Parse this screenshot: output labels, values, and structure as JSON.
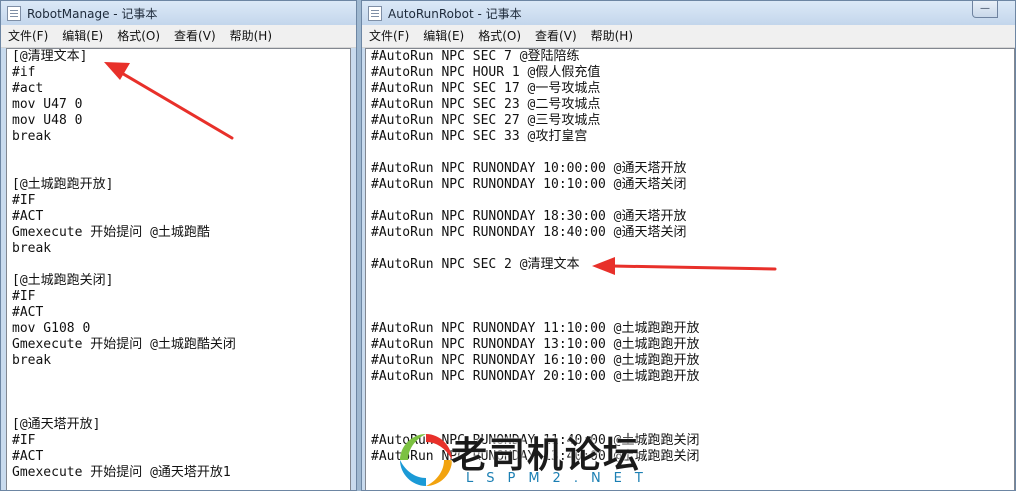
{
  "left_window": {
    "title": "RobotManage - 记事本",
    "menu": [
      "文件(F)",
      "编辑(E)",
      "格式(O)",
      "查看(V)",
      "帮助(H)"
    ],
    "lines": [
      "[@清理文本]",
      "#if",
      "#act",
      "mov U47 0",
      "mov U48 0",
      "break",
      "",
      "",
      "[@土城跑跑开放]",
      "#IF",
      "#ACT",
      "Gmexecute 开始提问 @土城跑酷",
      "break",
      "",
      "[@土城跑跑关闭]",
      "#IF",
      "#ACT",
      "mov G108 0",
      "Gmexecute 开始提问 @土城跑酷关闭",
      "break",
      "",
      "",
      "",
      "[@通天塔开放]",
      "#IF",
      "#ACT",
      "Gmexecute 开始提问 @通天塔开放1"
    ]
  },
  "right_window": {
    "title": "AutoRunRobot - 记事本",
    "menu": [
      "文件(F)",
      "编辑(E)",
      "格式(O)",
      "查看(V)",
      "帮助(H)"
    ],
    "lines": [
      "#AutoRun NPC SEC 7 @登陆陪练",
      "#AutoRun NPC HOUR 1 @假人假充值",
      "#AutoRun NPC SEC 17 @一号攻城点",
      "#AutoRun NPC SEC 23 @二号攻城点",
      "#AutoRun NPC SEC 27 @三号攻城点",
      "#AutoRun NPC SEC 33 @攻打皇宫",
      "",
      "#AutoRun NPC RUNONDAY 10:00:00 @通天塔开放",
      "#AutoRun NPC RUNONDAY 10:10:00 @通天塔关闭",
      "",
      "#AutoRun NPC RUNONDAY 18:30:00 @通天塔开放",
      "#AutoRun NPC RUNONDAY 18:40:00 @通天塔关闭",
      "",
      "#AutoRun NPC SEC 2 @清理文本",
      "",
      "",
      "",
      "#AutoRun NPC RUNONDAY 11:10:00 @土城跑跑开放",
      "#AutoRun NPC RUNONDAY 13:10:00 @土城跑跑开放",
      "#AutoRun NPC RUNONDAY 16:10:00 @土城跑跑开放",
      "#AutoRun NPC RUNONDAY 20:10:00 @土城跑跑开放",
      "",
      "",
      "",
      "#AutoRun NPC RUNONDAY 11:40:00 @土城跑跑关闭",
      "#AutoRun NPC RUNONDAY 13:40:00 @土城跑跑关闭"
    ]
  },
  "watermark": {
    "title": "老司机论坛",
    "domain": "LSPM2.NET"
  },
  "colors": {
    "arrow": "#e8302a",
    "titlebar": "#c9dbee"
  }
}
